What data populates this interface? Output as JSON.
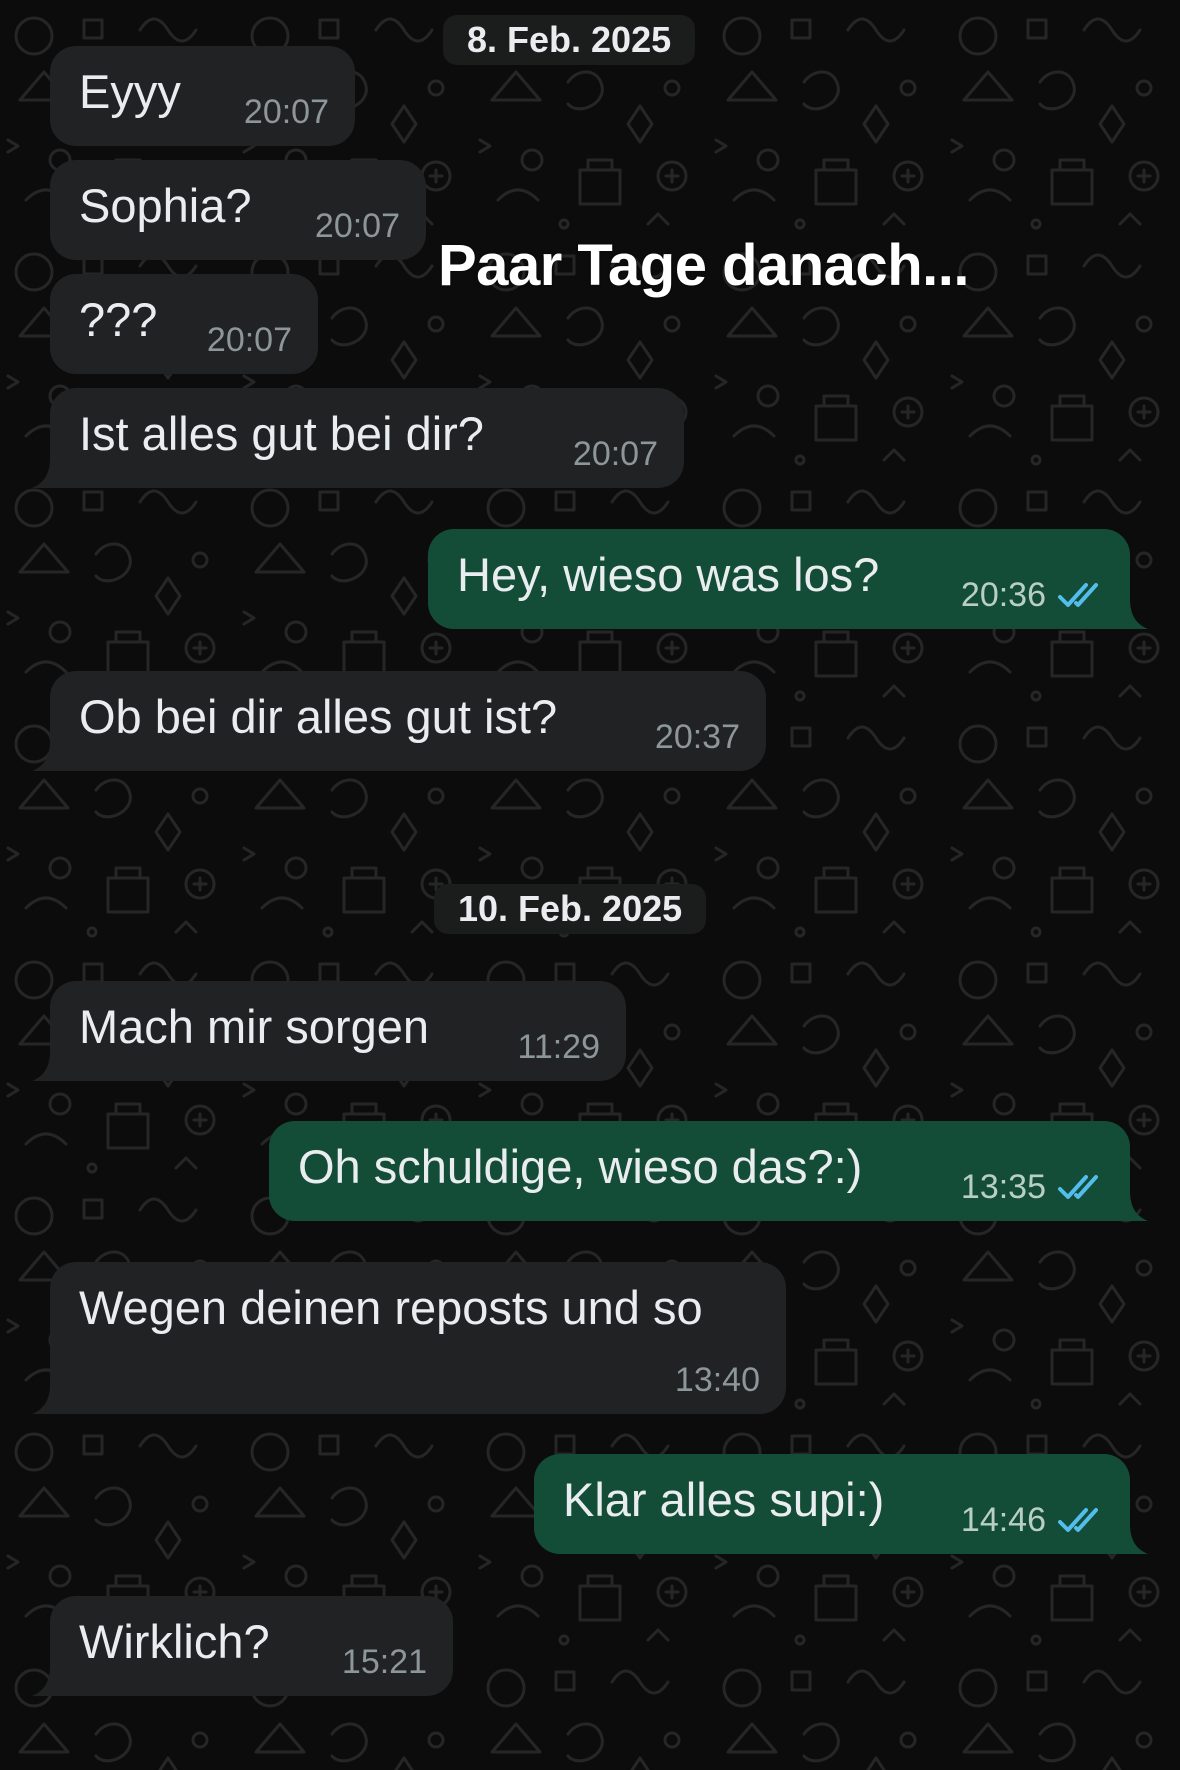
{
  "colors": {
    "background": "#0c0c0c",
    "incoming_bubble": "#202223",
    "outgoing_bubble": "#144d37",
    "date_pill": "#1b1c1c",
    "read_ticks": "#53bdeb",
    "text": "#e9edef",
    "timestamp": "#8d9699"
  },
  "overlay": {
    "caption": "Paar Tage danach..."
  },
  "dates": [
    "8. Feb. 2025",
    "10. Feb. 2025"
  ],
  "messages": [
    {
      "direction": "incoming",
      "text": "Eyyy",
      "time": "20:07"
    },
    {
      "direction": "incoming",
      "text": "Sophia?",
      "time": "20:07"
    },
    {
      "direction": "incoming",
      "text": "???",
      "time": "20:07"
    },
    {
      "direction": "incoming",
      "text": "Ist alles gut bei dir?",
      "time": "20:07"
    },
    {
      "direction": "outgoing",
      "text": "Hey, wieso was los?",
      "time": "20:36",
      "status_icon": "double-check-read-icon"
    },
    {
      "direction": "incoming",
      "text": "Ob bei dir alles gut ist?",
      "time": "20:37"
    },
    {
      "direction": "incoming",
      "text": "Mach mir sorgen",
      "time": "11:29"
    },
    {
      "direction": "outgoing",
      "text": "Oh schuldige, wieso das?:)",
      "time": "13:35",
      "status_icon": "double-check-read-icon"
    },
    {
      "direction": "incoming",
      "text": "Wegen deinen reposts und so",
      "time": "13:40"
    },
    {
      "direction": "outgoing",
      "text": "Klar alles supi:)",
      "time": "14:46",
      "status_icon": "double-check-read-icon"
    },
    {
      "direction": "incoming",
      "text": "Wirklich?",
      "time": "15:21"
    }
  ]
}
